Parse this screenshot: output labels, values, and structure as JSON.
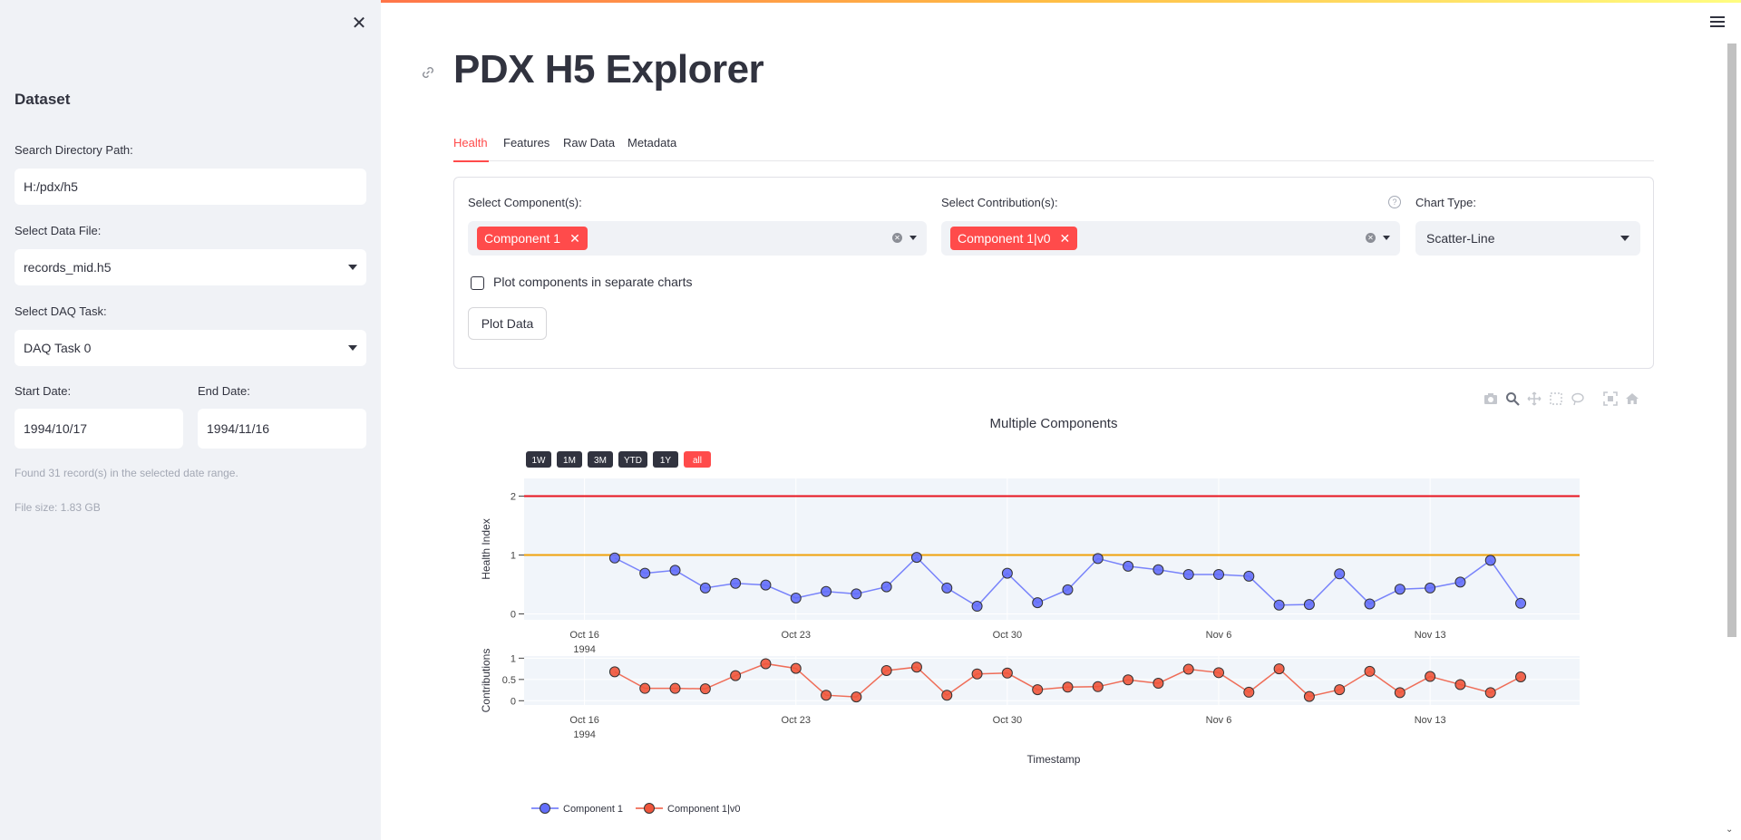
{
  "sidebar": {
    "close_icon": "close-icon",
    "heading": "Dataset",
    "search_label": "Search Directory Path:",
    "search_value": "H:/pdx/h5",
    "file_label": "Select Data File:",
    "file_value": "records_mid.h5",
    "daq_label": "Select DAQ Task:",
    "daq_value": "DAQ Task 0",
    "start_label": "Start Date:",
    "start_value": "1994/10/17",
    "end_label": "End Date:",
    "end_value": "1994/11/16",
    "found_text": "Found 31 record(s) in the selected date range.",
    "size_text": "File size: 1.83 GB"
  },
  "main": {
    "title": "PDX H5 Explorer",
    "tabs": [
      {
        "label": "Health"
      },
      {
        "label": "Features"
      },
      {
        "label": "Raw Data"
      },
      {
        "label": "Metadata"
      }
    ],
    "components_label": "Select Component(s):",
    "components_tag": "Component 1",
    "contrib_label": "Select Contribution(s):",
    "contrib_tag": "Component 1|v0",
    "chart_type_label": "Chart Type:",
    "chart_type_value": "Scatter-Line",
    "separate_label": "Plot components in separate charts",
    "plot_button": "Plot Data"
  },
  "colors": {
    "accent": "#ff4b4b",
    "series_health": "#636efa",
    "series_contrib": "#ef553b",
    "threshold_high": "#e8141e",
    "threshold_low": "#f0a10a"
  },
  "chart_data": {
    "type": "line",
    "title": "Multiple Components",
    "range_buttons": [
      "1W",
      "1M",
      "3M",
      "YTD",
      "1Y",
      "all"
    ],
    "active_range": "all",
    "x": [
      "1994-10-17",
      "1994-10-18",
      "1994-10-19",
      "1994-10-20",
      "1994-10-21",
      "1994-10-22",
      "1994-10-23",
      "1994-10-24",
      "1994-10-25",
      "1994-10-26",
      "1994-10-27",
      "1994-10-28",
      "1994-10-29",
      "1994-10-30",
      "1994-10-31",
      "1994-11-01",
      "1994-11-02",
      "1994-11-03",
      "1994-11-04",
      "1994-11-05",
      "1994-11-06",
      "1994-11-07",
      "1994-11-08",
      "1994-11-09",
      "1994-11-10",
      "1994-11-11",
      "1994-11-12",
      "1994-11-13",
      "1994-11-14",
      "1994-11-15",
      "1994-11-16"
    ],
    "xticks": [
      {
        "date": "1994-10-16",
        "label": "Oct 16",
        "sub": "1994"
      },
      {
        "date": "1994-10-23",
        "label": "Oct 23",
        "sub": ""
      },
      {
        "date": "1994-10-30",
        "label": "Oct 30",
        "sub": ""
      },
      {
        "date": "1994-11-06",
        "label": "Nov 6",
        "sub": ""
      },
      {
        "date": "1994-11-13",
        "label": "Nov 13",
        "sub": ""
      }
    ],
    "xlabel": "Timestamp",
    "panels": [
      {
        "ylabel": "Health Index",
        "yticks": [
          0,
          1,
          2
        ],
        "ylim": [
          -0.1,
          2.3
        ],
        "thresholds": [
          2,
          1
        ],
        "series": [
          {
            "name": "Component 1",
            "values": [
              0.95,
              0.69,
              0.74,
              0.44,
              0.52,
              0.49,
              0.27,
              0.38,
              0.34,
              0.46,
              0.96,
              0.44,
              0.13,
              0.69,
              0.19,
              0.41,
              0.94,
              0.81,
              0.75,
              0.67,
              0.67,
              0.64,
              0.15,
              0.16,
              0.68,
              0.17,
              0.42,
              0.44,
              0.54,
              0.91,
              0.18
            ]
          }
        ]
      },
      {
        "ylabel": "Contributions",
        "yticks": [
          0,
          0.5,
          1
        ],
        "ylim": [
          -0.1,
          1.05
        ],
        "thresholds": [],
        "series": [
          {
            "name": "Component 1|v0",
            "values": [
              0.68,
              0.29,
              0.29,
              0.28,
              0.59,
              0.87,
              0.76,
              0.13,
              0.09,
              0.71,
              0.79,
              0.13,
              0.63,
              0.65,
              0.26,
              0.32,
              0.33,
              0.49,
              0.41,
              0.74,
              0.66,
              0.2,
              0.75,
              0.1,
              0.26,
              0.69,
              0.19,
              0.57,
              0.38,
              0.19,
              0.56
            ]
          }
        ]
      }
    ],
    "legend": [
      "Component 1",
      "Component 1|v0"
    ]
  }
}
